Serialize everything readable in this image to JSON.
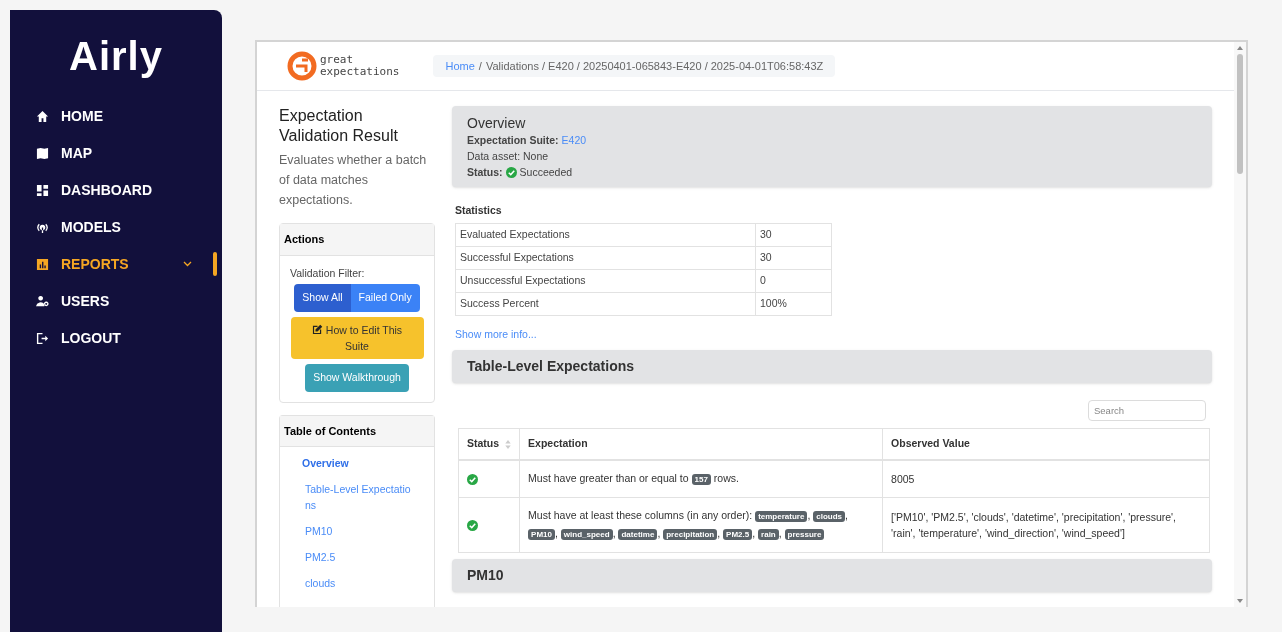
{
  "sidebar": {
    "logo": "Airly",
    "items": [
      {
        "label": "HOME",
        "selected": false,
        "expandable": false
      },
      {
        "label": "MAP",
        "selected": false,
        "expandable": false
      },
      {
        "label": "DASHBOARD",
        "selected": false,
        "expandable": false
      },
      {
        "label": "MODELS",
        "selected": false,
        "expandable": false
      },
      {
        "label": "REPORTS",
        "selected": true,
        "expandable": true
      },
      {
        "label": "USERS",
        "selected": false,
        "expandable": false
      },
      {
        "label": "LOGOUT",
        "selected": false,
        "expandable": false
      }
    ]
  },
  "header": {
    "brand": [
      "great",
      "expectations"
    ],
    "breadcrumb": {
      "home": "Home",
      "separator": "/",
      "path": "Validations / E420 / 20250401-065843-E420 / 2025-04-01T06:58:43Z"
    }
  },
  "intro": {
    "title": "Expectation Validation Result",
    "description": "Evaluates whether a batch of data matches expectations."
  },
  "actions": {
    "title": "Actions",
    "filter_label": "Validation Filter:",
    "filters": [
      {
        "label": "Show All",
        "selected": true
      },
      {
        "label": "Failed Only",
        "selected": false
      }
    ],
    "edit_button": "How to Edit This Suite",
    "walkthrough_button": "Show Walkthrough"
  },
  "toc": {
    "title": "Table of Contents",
    "items": [
      {
        "label": "Overview",
        "selected": true
      },
      {
        "label": "Table-Level Expectatio ns",
        "selected": false
      },
      {
        "label": "PM10",
        "selected": false
      },
      {
        "label": "PM2.5",
        "selected": false
      },
      {
        "label": "clouds",
        "selected": false
      }
    ]
  },
  "overview": {
    "title": "Overview",
    "suite": {
      "label": "Expectation Suite:",
      "value": "E420"
    },
    "data_asset": "Data asset: None",
    "status": {
      "label": "Status:",
      "value": "Succeeded",
      "passed": true
    }
  },
  "statistics": {
    "title": "Statistics",
    "rows": [
      [
        "Evaluated Expectations",
        "30"
      ],
      [
        "Successful Expectations",
        "30"
      ],
      [
        "Unsuccessful Expectations",
        "0"
      ],
      [
        "Success Percent",
        "100%"
      ]
    ],
    "more_link": "Show more info..."
  },
  "sections": [
    {
      "title": "Table-Level Expectations",
      "search_placeholder": "Search",
      "columns": [
        "Status",
        "Expectation",
        "Observed Value"
      ],
      "rows": [
        {
          "passed": true,
          "expectation": [
            {
              "kind": "text",
              "text": "Must have greater than or equal to"
            },
            {
              "kind": "code",
              "text": "157"
            },
            {
              "kind": "text",
              "text": "rows."
            }
          ],
          "observed": "8005"
        },
        {
          "passed": true,
          "expectation": [
            {
              "kind": "text",
              "text": "Must have at least these columns (in any order):"
            },
            {
              "kind": "code",
              "text": "temperature"
            },
            {
              "kind": "text",
              "text": ","
            },
            {
              "kind": "code",
              "text": "clouds"
            },
            {
              "kind": "text",
              "text": ","
            },
            {
              "kind": "code",
              "text": "PM10"
            },
            {
              "kind": "text",
              "text": ","
            },
            {
              "kind": "code",
              "text": "wind_speed"
            },
            {
              "kind": "text",
              "text": ","
            },
            {
              "kind": "code",
              "text": "datetime"
            },
            {
              "kind": "text",
              "text": ","
            },
            {
              "kind": "code",
              "text": "precipitation"
            },
            {
              "kind": "text",
              "text": ","
            },
            {
              "kind": "code",
              "text": "PM2.5"
            },
            {
              "kind": "text",
              "text": ","
            },
            {
              "kind": "code",
              "text": "rain"
            },
            {
              "kind": "text",
              "text": ","
            },
            {
              "kind": "code",
              "text": "pressure"
            }
          ],
          "observed": "['PM10', 'PM2.5', 'clouds', 'datetime', 'precipitation', 'pressure', 'rain', 'temperature', 'wind_direction', 'wind_speed']"
        }
      ]
    },
    {
      "title": "PM10"
    }
  ]
}
